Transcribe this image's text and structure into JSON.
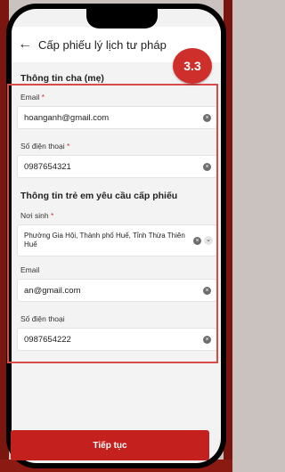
{
  "header": {
    "title": "Cấp phiếu lý lịch tư pháp"
  },
  "badge": "3.3",
  "parent_section": {
    "title": "Thông tin cha (mẹ)",
    "email": {
      "label": "Email",
      "required": "*",
      "value": "hoanganh@gmail.com"
    },
    "phone": {
      "label": "Số điện thoại",
      "required": "*",
      "value": "0987654321"
    }
  },
  "child_section": {
    "title": "Thông tin trẻ em yêu cầu cấp phiếu",
    "birthplace": {
      "label": "Nơi sinh",
      "required": "*",
      "value": "Phường Gia Hội, Thành phố Huế, Tỉnh Thừa Thiên Huế"
    },
    "email": {
      "label": "Email",
      "value": "an@gmail.com"
    },
    "phone": {
      "label": "Số điện thoại",
      "value": "0987654222"
    }
  },
  "footer": {
    "continue_label": "Tiếp tục"
  },
  "colors": {
    "accent": "#c3201e",
    "highlight": "#d94a4a"
  }
}
